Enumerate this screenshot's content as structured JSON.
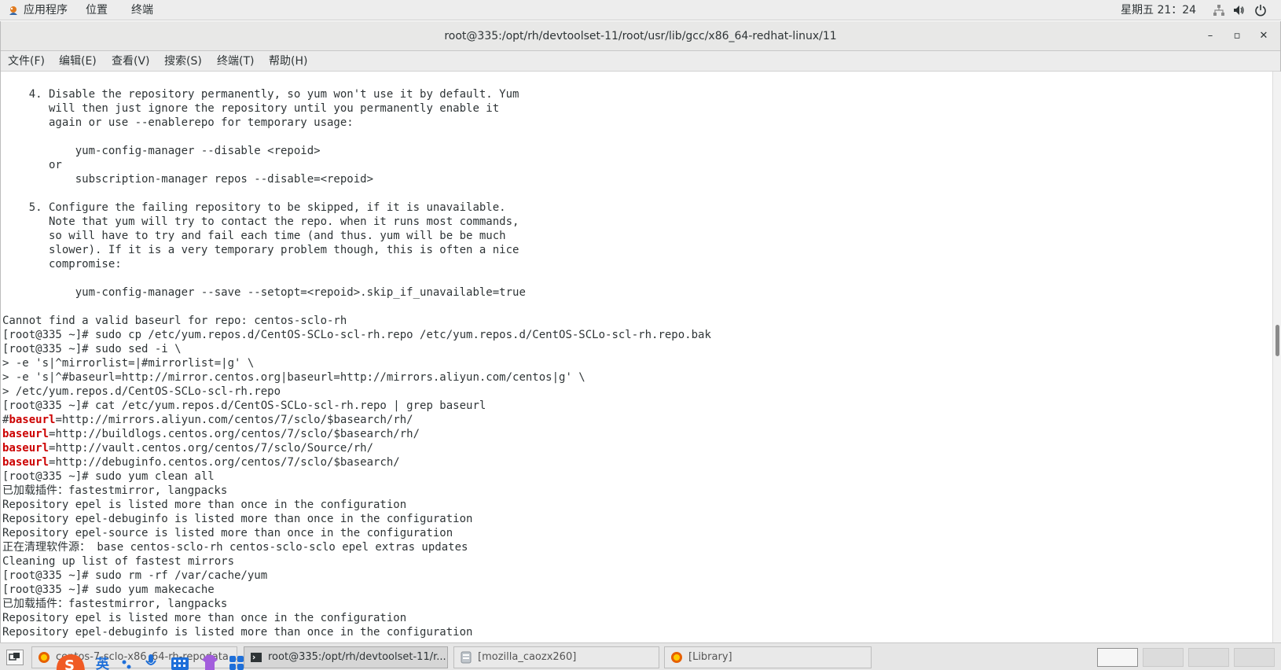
{
  "topbar": {
    "menus": [
      "应用程序",
      "位置",
      "终端"
    ],
    "clock": "星期五 21：24"
  },
  "window": {
    "title": "root@335:/opt/rh/devtoolset-11/root/usr/lib/gcc/x86_64-redhat-linux/11",
    "minimize_label": "–",
    "maximize_label": "▫",
    "close_label": "✕"
  },
  "menubar": [
    "文件(F)",
    "编辑(E)",
    "查看(V)",
    "搜索(S)",
    "终端(T)",
    "帮助(H)"
  ],
  "terminal": {
    "lines": [
      [
        {
          "t": "    4. Disable the repository permanently, so yum won't use it by default. Yum"
        }
      ],
      [
        {
          "t": "       will then just ignore the repository until you permanently enable it"
        }
      ],
      [
        {
          "t": "       again or use --enablerepo for temporary usage:"
        }
      ],
      [
        {
          "t": ""
        }
      ],
      [
        {
          "t": "           yum-config-manager --disable <repoid>"
        }
      ],
      [
        {
          "t": "       or"
        }
      ],
      [
        {
          "t": "           subscription-manager repos --disable=<repoid>"
        }
      ],
      [
        {
          "t": ""
        }
      ],
      [
        {
          "t": "    5. Configure the failing repository to be skipped, if it is unavailable."
        }
      ],
      [
        {
          "t": "       Note that yum will try to contact the repo. when it runs most commands,"
        }
      ],
      [
        {
          "t": "       so will have to try and fail each time (and thus. yum will be be much"
        }
      ],
      [
        {
          "t": "       slower). If it is a very temporary problem though, this is often a nice"
        }
      ],
      [
        {
          "t": "       compromise:"
        }
      ],
      [
        {
          "t": ""
        }
      ],
      [
        {
          "t": "           yum-config-manager --save --setopt=<repoid>.skip_if_unavailable=true"
        }
      ],
      [
        {
          "t": ""
        }
      ],
      [
        {
          "t": "Cannot find a valid baseurl for repo: centos-sclo-rh"
        }
      ],
      [
        {
          "t": "[root@335 ~]# sudo cp /etc/yum.repos.d/CentOS-SCLo-scl-rh.repo /etc/yum.repos.d/CentOS-SCLo-scl-rh.repo.bak"
        }
      ],
      [
        {
          "t": "[root@335 ~]# sudo sed -i \\"
        }
      ],
      [
        {
          "t": "> -e 's|^mirrorlist=|#mirrorlist=|g' \\"
        }
      ],
      [
        {
          "t": "> -e 's|^#baseurl=http://mirror.centos.org|baseurl=http://mirrors.aliyun.com/centos|g' \\"
        }
      ],
      [
        {
          "t": "> /etc/yum.repos.d/CentOS-SCLo-scl-rh.repo"
        }
      ],
      [
        {
          "t": "[root@335 ~]# cat /etc/yum.repos.d/CentOS-SCLo-scl-rh.repo | grep baseurl"
        }
      ],
      [
        {
          "t": "#"
        },
        {
          "t": "baseurl",
          "hl": true
        },
        {
          "t": "=http://mirrors.aliyun.com/centos/7/sclo/$basearch/rh/"
        }
      ],
      [
        {
          "t": "baseurl",
          "hl": true
        },
        {
          "t": "=http://buildlogs.centos.org/centos/7/sclo/$basearch/rh/"
        }
      ],
      [
        {
          "t": "baseurl",
          "hl": true
        },
        {
          "t": "=http://vault.centos.org/centos/7/sclo/Source/rh/"
        }
      ],
      [
        {
          "t": "baseurl",
          "hl": true
        },
        {
          "t": "=http://debuginfo.centos.org/centos/7/sclo/$basearch/"
        }
      ],
      [
        {
          "t": "[root@335 ~]# sudo yum clean all"
        }
      ],
      [
        {
          "t": "已加载插件：fastestmirror, langpacks"
        }
      ],
      [
        {
          "t": "Repository epel is listed more than once in the configuration"
        }
      ],
      [
        {
          "t": "Repository epel-debuginfo is listed more than once in the configuration"
        }
      ],
      [
        {
          "t": "Repository epel-source is listed more than once in the configuration"
        }
      ],
      [
        {
          "t": "正在清理软件源： base centos-sclo-rh centos-sclo-sclo epel extras updates"
        }
      ],
      [
        {
          "t": "Cleaning up list of fastest mirrors"
        }
      ],
      [
        {
          "t": "[root@335 ~]# sudo rm -rf /var/cache/yum"
        }
      ],
      [
        {
          "t": "[root@335 ~]# sudo yum makecache"
        }
      ],
      [
        {
          "t": "已加载插件：fastestmirror, langpacks"
        }
      ],
      [
        {
          "t": "Repository epel is listed more than once in the configuration"
        }
      ],
      [
        {
          "t": "Repository epel-debuginfo is listed more than once in the configuration"
        }
      ]
    ],
    "scroll_position": 0.47
  },
  "taskbar": {
    "tasks": [
      {
        "label": "centos-7-sclo-x86_64-rh-repodata ...",
        "icon": "firefox-icon",
        "active": false
      },
      {
        "label": "root@335:/opt/rh/devtoolset-11/r...",
        "icon": "terminal-icon",
        "active": true
      },
      {
        "label": "[mozilla_caozx260]",
        "icon": "file-manager-icon",
        "active": false
      },
      {
        "label": "[Library]",
        "icon": "firefox-icon",
        "active": false
      }
    ],
    "workspaces": 4,
    "active_workspace": 0
  },
  "ime": {
    "lang_label": "英",
    "icons": [
      "sogou-logo-icon",
      "punctuation-icon",
      "microphone-icon",
      "keyboard-icon",
      "skin-icon",
      "toolbox-icon"
    ]
  },
  "colors": {
    "highlight": "#cc0000",
    "terminal_fg": "#2e3436",
    "terminal_bg": "#ffffff"
  }
}
